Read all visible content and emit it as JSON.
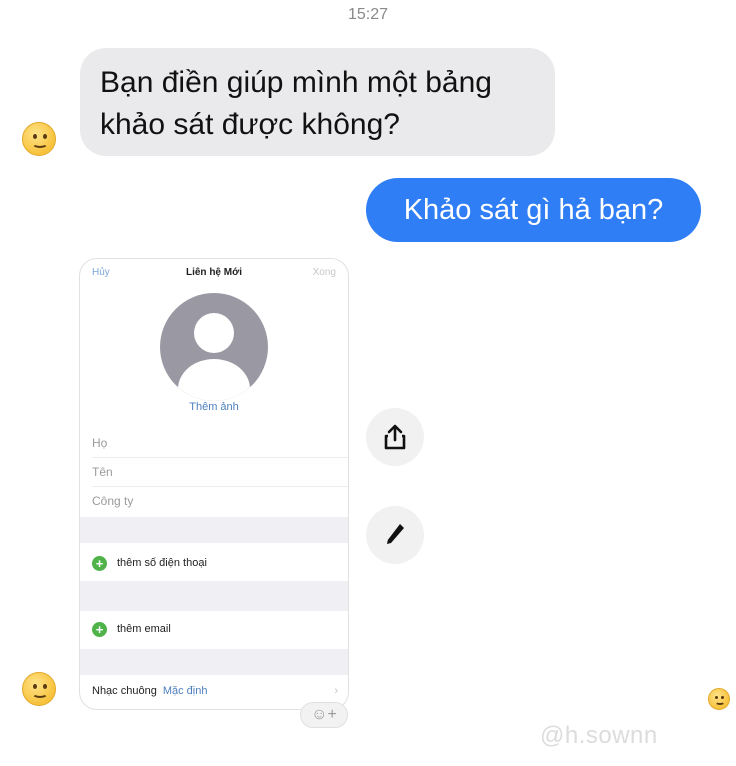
{
  "timestamp": "15:27",
  "messages": {
    "incoming": "Bạn điền giúp mình một bảng khảo sát được không?",
    "outgoing": "Khảo sát gì hả bạn?"
  },
  "shared_screenshot": {
    "nav": {
      "cancel": "Hủy",
      "title": "Liên hệ Mới",
      "done": "Xong"
    },
    "add_photo": "Thêm ảnh",
    "fields": [
      "Họ",
      "Tên",
      "Công ty"
    ],
    "add_phone": "thêm số điện thoại",
    "add_email": "thêm email",
    "ringtone_label": "Nhạc chuông",
    "ringtone_value": "Mặc định"
  },
  "actions": {
    "share_icon": "share-icon",
    "edit_icon": "pencil-icon"
  },
  "reaction_add": "☺+",
  "watermark": "@h.sownn",
  "colors": {
    "outgoing_bubble": "#2f7ef5",
    "incoming_bubble": "#eaeaec",
    "ios_link": "#4d7fbe",
    "add_green": "#4fb34a"
  }
}
